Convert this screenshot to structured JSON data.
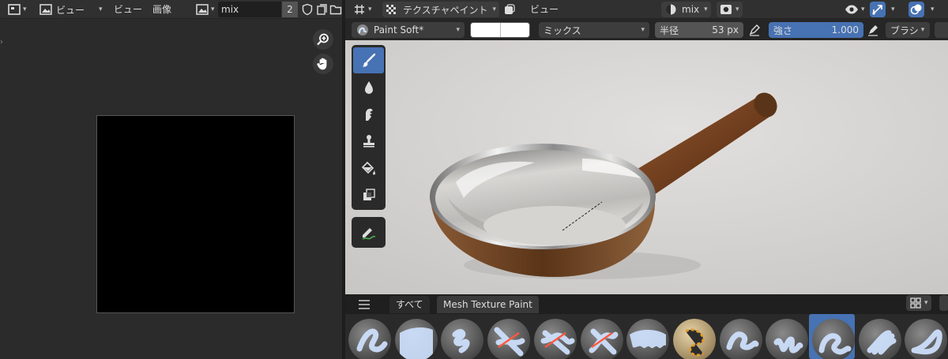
{
  "image_editor": {
    "view_menu": "ビュー",
    "menus": [
      "ビュー",
      "画像"
    ],
    "image_name": "mix",
    "users_count": "2"
  },
  "viewport": {
    "mode": "テクスチャペイント",
    "view_menu": "ビュー",
    "texture_slot": "mix",
    "brush_name": "Paint Soft*",
    "blend_mode": "ミックス",
    "radius_label": "半径",
    "radius_value": "53 px",
    "strength_label": "強さ",
    "strength_value": "1.000",
    "brush_menu": "ブラシ"
  },
  "palette": {
    "tabs": [
      "すべて",
      "Mesh Texture Paint"
    ],
    "brush_count": 13,
    "active_brush_index": 10
  },
  "colors": {
    "accent": "#4772b3",
    "primary_color": "#ffffff"
  }
}
